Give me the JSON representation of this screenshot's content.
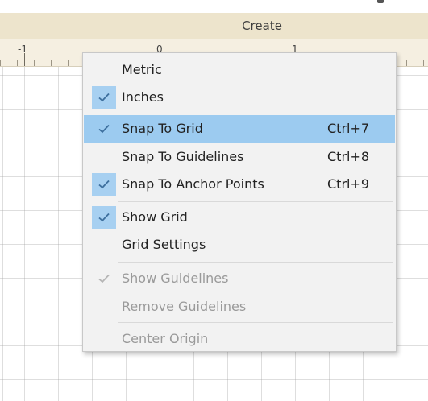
{
  "header": {
    "create_label": "Create"
  },
  "ruler": {
    "labels": [
      "-1",
      "0",
      "1"
    ]
  },
  "menu": {
    "items": [
      {
        "label": "Metric",
        "shortcut": "",
        "checked": false
      },
      {
        "label": "Inches",
        "shortcut": "",
        "checked": true
      },
      {
        "label": "Snap To Grid",
        "shortcut": "Ctrl+7",
        "checked": true,
        "highlighted": true
      },
      {
        "label": "Snap To Guidelines",
        "shortcut": "Ctrl+8",
        "checked": false
      },
      {
        "label": "Snap To Anchor Points",
        "shortcut": "Ctrl+9",
        "checked": true
      },
      {
        "label": "Show Grid",
        "shortcut": "",
        "checked": true
      },
      {
        "label": "Grid Settings",
        "shortcut": "",
        "checked": false
      },
      {
        "label": "Show Guidelines",
        "shortcut": "",
        "checked": true,
        "disabled": true
      },
      {
        "label": "Remove Guidelines",
        "shortcut": "",
        "checked": false,
        "disabled": true
      },
      {
        "label": "Center Origin",
        "shortcut": "",
        "checked": false,
        "disabled": true
      }
    ]
  },
  "colors": {
    "highlight": "#9ccbf0",
    "check": "#3d6f9e",
    "check_disabled": "#b5b5b5",
    "header_bg": "#ede4cc"
  }
}
